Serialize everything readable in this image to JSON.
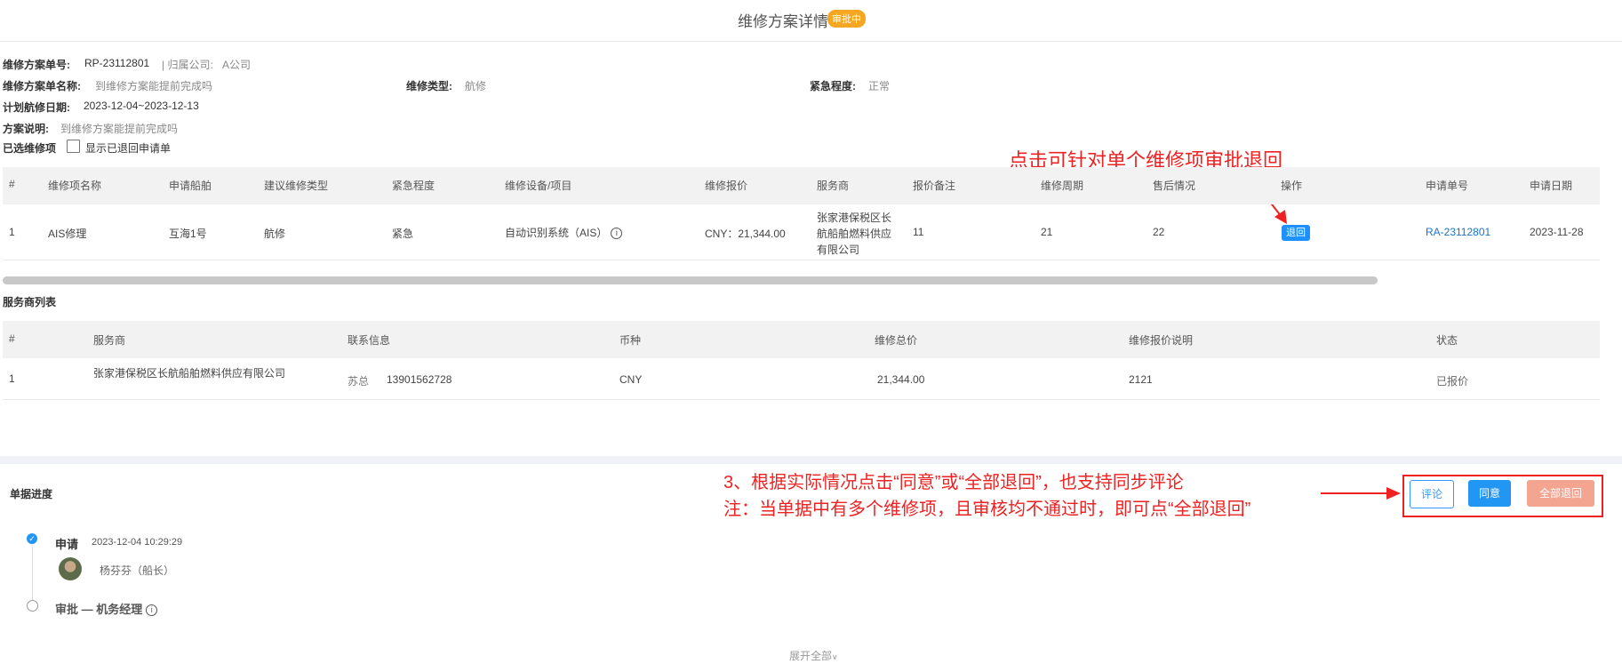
{
  "header": {
    "title": "维修方案详情",
    "status": "审批中"
  },
  "info": {
    "plan_no_label": "维修方案单号:",
    "plan_no": "RP-23112801",
    "company_label": "| 归属公司:",
    "company": "A公司",
    "plan_name_label": "维修方案单名称:",
    "plan_name": "到维修方案能提前完成吗",
    "type_label": "维修类型:",
    "type": "航修",
    "urgency_label": "紧急程度:",
    "urgency": "正常",
    "date_label": "计划航修日期:",
    "date": "2023-12-04~2023-12-13",
    "desc_label": "方案说明:",
    "desc": "到维修方案能提前完成吗",
    "selected_label": "已选维修项",
    "show_returned_label": "显示已退回申请单"
  },
  "items_table": {
    "headers": [
      "#",
      "维修项名称",
      "申请船舶",
      "建议维修类型",
      "紧急程度",
      "维修设备/项目",
      "维修报价",
      "服务商",
      "报价备注",
      "维修周期",
      "售后情况",
      "操作",
      "申请单号",
      "申请日期"
    ],
    "rows": [
      {
        "idx": "1",
        "name": "AIS修理",
        "ship": "互海1号",
        "type": "航修",
        "urgency": "紧急",
        "equipment": "自动识别系统（AIS）",
        "price": "CNY：21,344.00",
        "supplier_l1": "张家港保税区长",
        "supplier_l2": "航船舶燃料供应",
        "supplier_l3": "有限公司",
        "remark": "11",
        "cycle": "21",
        "after_sale": "22",
        "action": "退回",
        "req_no": "RA-23112801",
        "req_date": "2023-11-28"
      }
    ]
  },
  "annotations": {
    "single_return": "点击可针对单个维修项审批退回",
    "step3_l1": "3、根据实际情况点击“同意”或“全部退回”，也支持同步评论",
    "step3_l2": "注：当单据中有多个维修项，且审核均不通过时，即可点“全部退回”"
  },
  "supplier_table": {
    "title": "服务商列表",
    "headers": [
      "#",
      "服务商",
      "联系信息",
      "币种",
      "维修总价",
      "维修报价说明",
      "状态"
    ],
    "rows": [
      {
        "idx": "1",
        "supplier": "张家港保税区长航船舶燃料供应有限公司",
        "contact_name": "苏总",
        "contact_phone": "13901562728",
        "currency": "CNY",
        "total": "21,344.00",
        "note": "2121",
        "status": "已报价"
      }
    ]
  },
  "progress": {
    "title": "单据进度",
    "buttons": {
      "comment": "评论",
      "agree": "同意",
      "reject_all": "全部退回"
    },
    "steps": [
      {
        "name": "申请",
        "time": "2023-12-04 10:29:29",
        "person": "杨芬芬（船长）"
      },
      {
        "name": "审批 — 机务经理"
      }
    ],
    "expand_all": "展开全部"
  },
  "colors": {
    "accent": "#2196f3",
    "badge": "#f5a623",
    "annotation": "#ee2222",
    "reject": "#f4a592"
  }
}
